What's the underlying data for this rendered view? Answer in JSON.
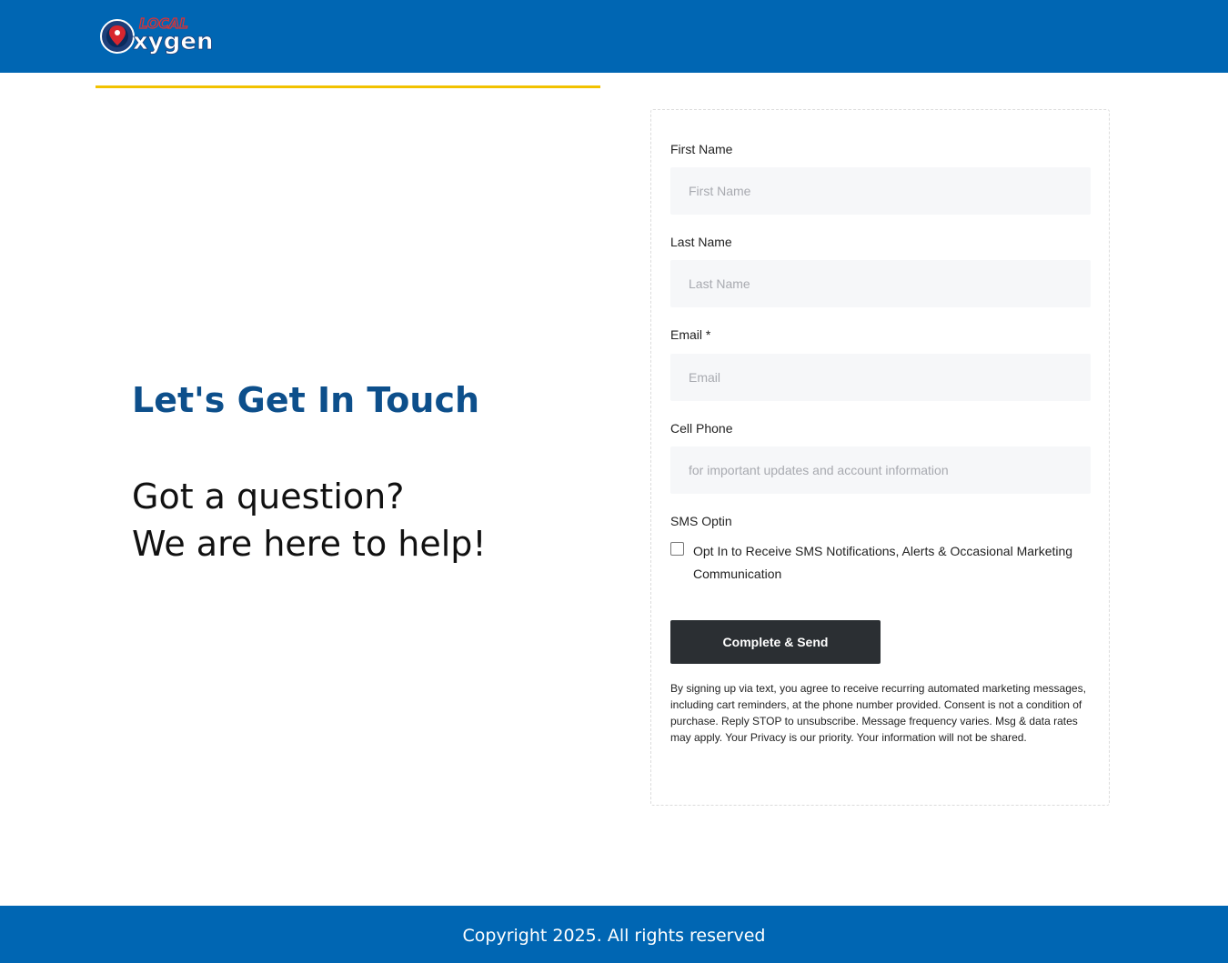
{
  "header": {
    "logo_text_top": "LOCAL",
    "logo_text_main": "xygen",
    "logo_icon": "map-pin-icon",
    "brand_color": "#0066b3",
    "accent_color": "#f2c200"
  },
  "hero": {
    "title": "Let's Get In Touch",
    "line1": "Got a question?",
    "line2": "We are here to help!"
  },
  "form": {
    "first_name_label": "First Name",
    "first_name_placeholder": "First Name",
    "last_name_label": "Last Name",
    "last_name_placeholder": "Last Name",
    "email_label": "Email *",
    "email_placeholder": "Email",
    "cell_label": "Cell Phone",
    "cell_placeholder": "for important updates and account information",
    "sms_label": "SMS Optin",
    "sms_option": "Opt In to Receive SMS Notifications, Alerts & Occasional Marketing Communication",
    "submit_label": "Complete & Send",
    "disclaimer": "By signing up via text, you agree to receive recurring automated marketing messages, including cart reminders, at the phone number provided. Consent is not a condition of purchase. Reply STOP to unsubscribe. Message frequency varies. Msg & data rates may apply. Your Privacy is our priority. Your information will not be shared."
  },
  "footer": {
    "copyright": "Copyright 2025. All rights reserved"
  }
}
